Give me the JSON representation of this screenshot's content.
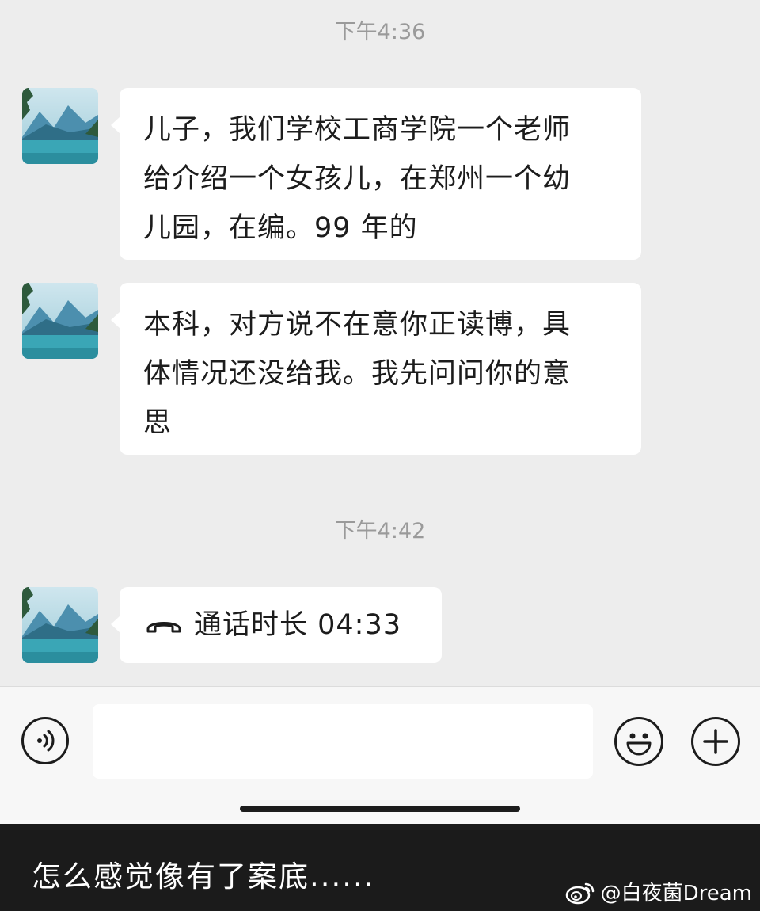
{
  "chat": {
    "timestamps": [
      "下午4:36",
      "下午4:42"
    ],
    "messages": [
      {
        "type": "text",
        "lines": [
          "儿子，我们学校工商学院一个老师",
          "给介绍一个女孩儿，在郑州一个幼",
          "儿园，在编。99 年的"
        ]
      },
      {
        "type": "text",
        "lines": [
          "本科，对方说不在意你正读博，具",
          "体情况还没给我。我先问问你的意",
          "思"
        ]
      },
      {
        "type": "call",
        "icon": "phone-hangup-icon",
        "text": "通话时长 04:33"
      }
    ]
  },
  "input_bar": {
    "voice_icon": "voice-icon",
    "input_value": "",
    "emoji_icon": "emoji-icon",
    "plus_icon": "plus-icon"
  },
  "caption": {
    "text": "怎么感觉像有了案底......",
    "watermark": "@白夜菌Dream",
    "watermark_icon": "weibo-logo-icon"
  },
  "colors": {
    "chat_background": "#ededed",
    "bubble": "#ffffff",
    "caption_background": "#1b1b1b"
  }
}
